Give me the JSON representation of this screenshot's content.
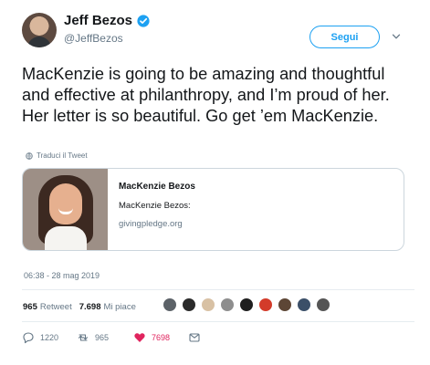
{
  "tweet": {
    "author": {
      "display_name": "Jeff Bezos",
      "handle": "@JeffBezos",
      "verified": true
    },
    "follow_label": "Segui",
    "menu_icon": "chevron-down-icon",
    "text": "MacKenzie is going to be amazing and thoughtful and effective at philanthropy, and I’m proud of her. Her letter is so beautiful. Go get ’em MacKenzie.",
    "translate_label": "Traduci il Tweet",
    "card": {
      "title": "MacKenzie Bezos",
      "description": "MacKenzie Bezos:",
      "domain": "givingpledge.org"
    },
    "timestamp": "06:38 - 28 mag 2019",
    "stats": {
      "retweets": "965",
      "retweets_label": "Retweet",
      "likes": "7.698",
      "likes_label": "Mi piace"
    },
    "actions": {
      "reply_count": "1220",
      "retweet_count": "965",
      "like_count": "7698"
    },
    "colors": {
      "accent": "#1da1f2",
      "text": "#14171a",
      "muted": "#657786",
      "like": "#e0245e",
      "border": "#ccd6dd"
    }
  }
}
